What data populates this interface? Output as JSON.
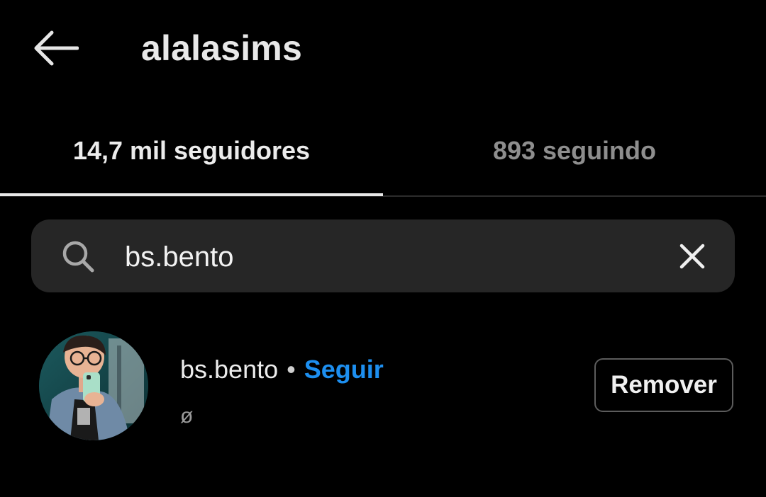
{
  "header": {
    "title": "alalasims",
    "back_icon": "arrow-left-icon"
  },
  "tabs": [
    {
      "label": "14,7 mil seguidores",
      "active": true
    },
    {
      "label": "893 seguindo",
      "active": false
    }
  ],
  "search": {
    "value": "bs.bento",
    "search_icon": "search-icon",
    "clear_icon": "close-icon"
  },
  "results": [
    {
      "username": "bs.bento",
      "separator": "•",
      "follow_label": "Seguir",
      "full_name": "ø",
      "remove_label": "Remover",
      "avatar_icon": "avatar"
    }
  ],
  "colors": {
    "background": "#000000",
    "search_background": "#262626",
    "accent_blue": "#1d8ff0",
    "secondary_text": "#8e8e8e",
    "primary_text": "#ececec"
  }
}
